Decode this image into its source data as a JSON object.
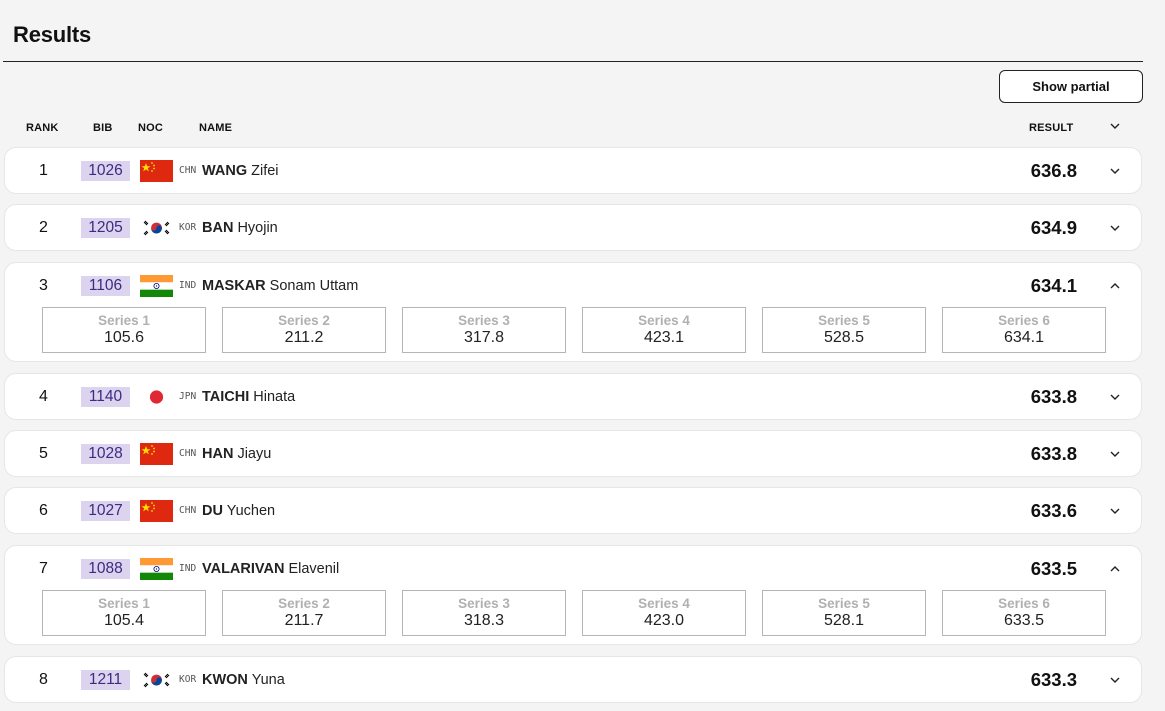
{
  "page": {
    "title": "Results",
    "show_partial_label": "Show partial"
  },
  "columns": {
    "rank": "RANK",
    "bib": "BIB",
    "noc": "NOC",
    "name": "NAME",
    "result": "RESULT"
  },
  "colors": {
    "bib_bg": "#dcd3ee",
    "bib_text": "#3d2a82",
    "series_label": "#b0b0b0"
  },
  "rows": [
    {
      "rank": "1",
      "bib": "1026",
      "noc": "CHN",
      "flag": "chn-flag",
      "surname": "WANG",
      "given": "Zifei",
      "result": "636.8",
      "expanded": false,
      "chevron": "chevron-down-icon",
      "series": []
    },
    {
      "rank": "2",
      "bib": "1205",
      "noc": "KOR",
      "flag": "kor-flag",
      "surname": "BAN",
      "given": "Hyojin",
      "result": "634.9",
      "expanded": false,
      "chevron": "chevron-down-icon",
      "series": []
    },
    {
      "rank": "3",
      "bib": "1106",
      "noc": "IND",
      "flag": "ind-flag",
      "surname": "MASKAR",
      "given": "Sonam Uttam",
      "result": "634.1",
      "expanded": true,
      "chevron": "chevron-up-icon",
      "series": [
        {
          "label": "Series 1",
          "value": "105.6"
        },
        {
          "label": "Series 2",
          "value": "211.2"
        },
        {
          "label": "Series 3",
          "value": "317.8"
        },
        {
          "label": "Series 4",
          "value": "423.1"
        },
        {
          "label": "Series 5",
          "value": "528.5"
        },
        {
          "label": "Series 6",
          "value": "634.1"
        }
      ]
    },
    {
      "rank": "4",
      "bib": "1140",
      "noc": "JPN",
      "flag": "jpn-flag",
      "surname": "TAICHI",
      "given": "Hinata",
      "result": "633.8",
      "expanded": false,
      "chevron": "chevron-down-icon",
      "series": []
    },
    {
      "rank": "5",
      "bib": "1028",
      "noc": "CHN",
      "flag": "chn-flag",
      "surname": "HAN",
      "given": "Jiayu",
      "result": "633.8",
      "expanded": false,
      "chevron": "chevron-down-icon",
      "series": []
    },
    {
      "rank": "6",
      "bib": "1027",
      "noc": "CHN",
      "flag": "chn-flag",
      "surname": "DU",
      "given": "Yuchen",
      "result": "633.6",
      "expanded": false,
      "chevron": "chevron-down-icon",
      "series": []
    },
    {
      "rank": "7",
      "bib": "1088",
      "noc": "IND",
      "flag": "ind-flag",
      "surname": "VALARIVAN",
      "given": "Elavenil",
      "result": "633.5",
      "expanded": true,
      "chevron": "chevron-up-icon",
      "series": [
        {
          "label": "Series 1",
          "value": "105.4"
        },
        {
          "label": "Series 2",
          "value": "211.7"
        },
        {
          "label": "Series 3",
          "value": "318.3"
        },
        {
          "label": "Series 4",
          "value": "423.0"
        },
        {
          "label": "Series 5",
          "value": "528.1"
        },
        {
          "label": "Series 6",
          "value": "633.5"
        }
      ]
    },
    {
      "rank": "8",
      "bib": "1211",
      "noc": "KOR",
      "flag": "kor-flag",
      "surname": "KWON",
      "given": "Yuna",
      "result": "633.3",
      "expanded": false,
      "chevron": "chevron-down-icon",
      "series": []
    }
  ]
}
